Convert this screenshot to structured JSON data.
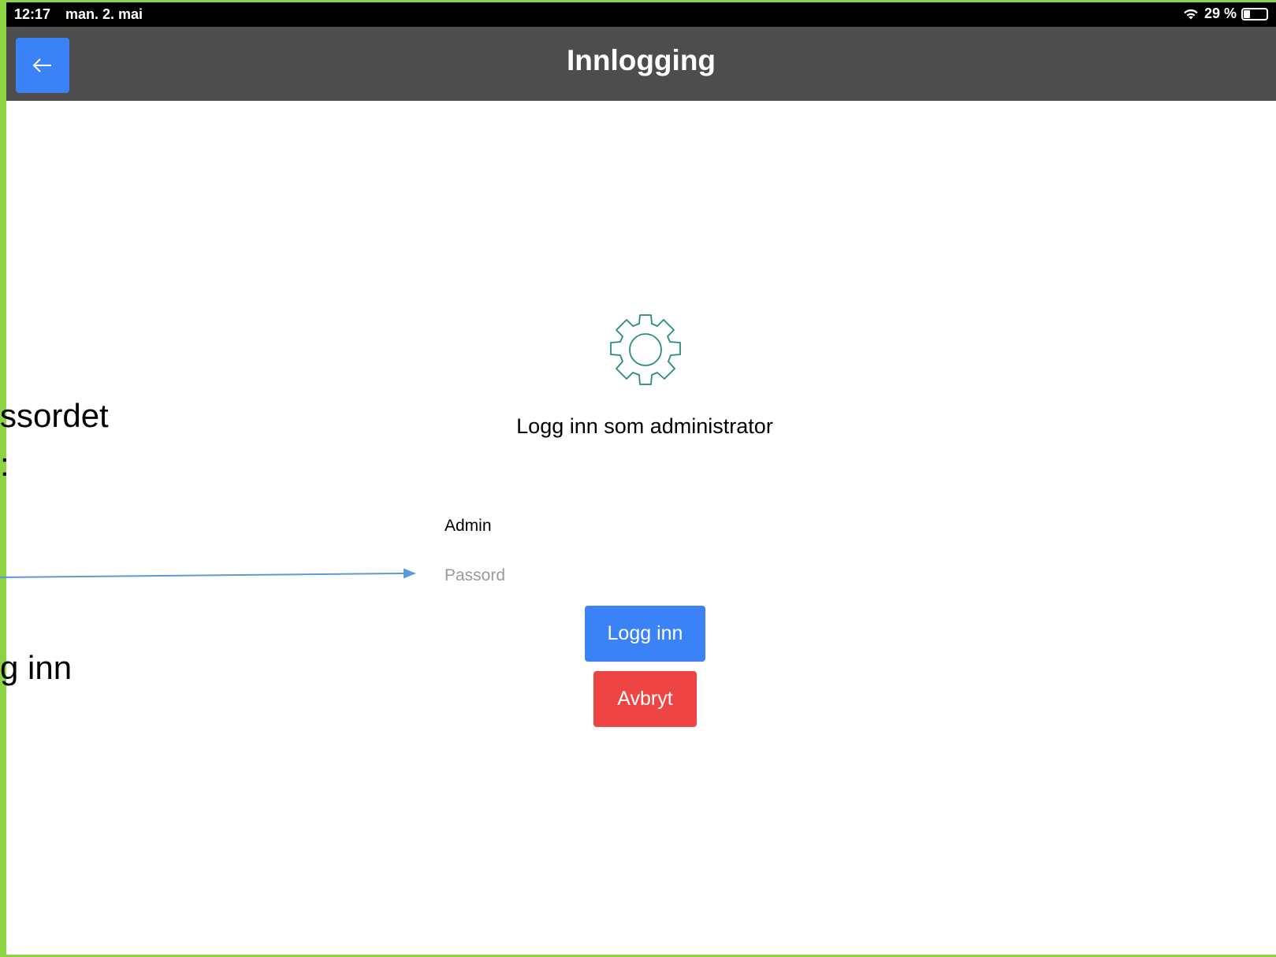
{
  "status_bar": {
    "time": "12:17",
    "date": "man. 2. mai",
    "battery": "29 %",
    "battery_level": 0.29
  },
  "header": {
    "title": "Innlogging",
    "back_label": "←"
  },
  "login": {
    "heading": "Logg inn som administrator",
    "username_value": "Admin",
    "password_placeholder": "Passord",
    "login_button": "Logg inn",
    "cancel_button": "Avbryt"
  },
  "annotations": {
    "line1": "ssordet",
    "line2": ":",
    "line3": "g inn"
  },
  "colors": {
    "accent_blue": "#3b82f6",
    "cancel_red": "#ef4444",
    "header_bg": "#4d4d4d",
    "gear_teal": "#2a8a80",
    "frame_green": "#8cd442",
    "arrow_blue": "#5b9bd5"
  }
}
